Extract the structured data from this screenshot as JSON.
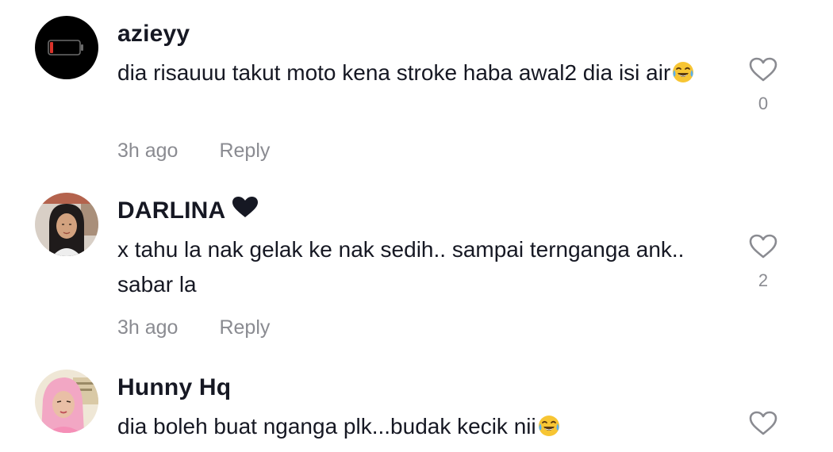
{
  "comments": [
    {
      "username": "azieyy",
      "text": "dia risauuu takut moto kena stroke haba awal2 dia isi air",
      "emoji": "face-with-tears-of-joy",
      "time": "3h ago",
      "reply_label": "Reply",
      "like_count": "0",
      "avatar": "battery-icon-avatar"
    },
    {
      "username": "DARLINA",
      "name_suffix_icon": "black-heart",
      "text": "x tahu la nak gelak ke nak sedih.. sampai ternganga ank.. sabar la",
      "time": "3h ago",
      "reply_label": "Reply",
      "like_count": "2",
      "avatar": "profile-photo"
    },
    {
      "username": "Hunny Hq",
      "text": "dia boleh buat nganga plk...budak kecik nii",
      "emoji": "face-with-tears-of-joy",
      "avatar": "profile-photo"
    }
  ],
  "icons": {
    "like": "heart-outline-icon"
  },
  "colors": {
    "primary_text": "#161823",
    "secondary_text": "#8a8b91",
    "background": "#ffffff"
  }
}
